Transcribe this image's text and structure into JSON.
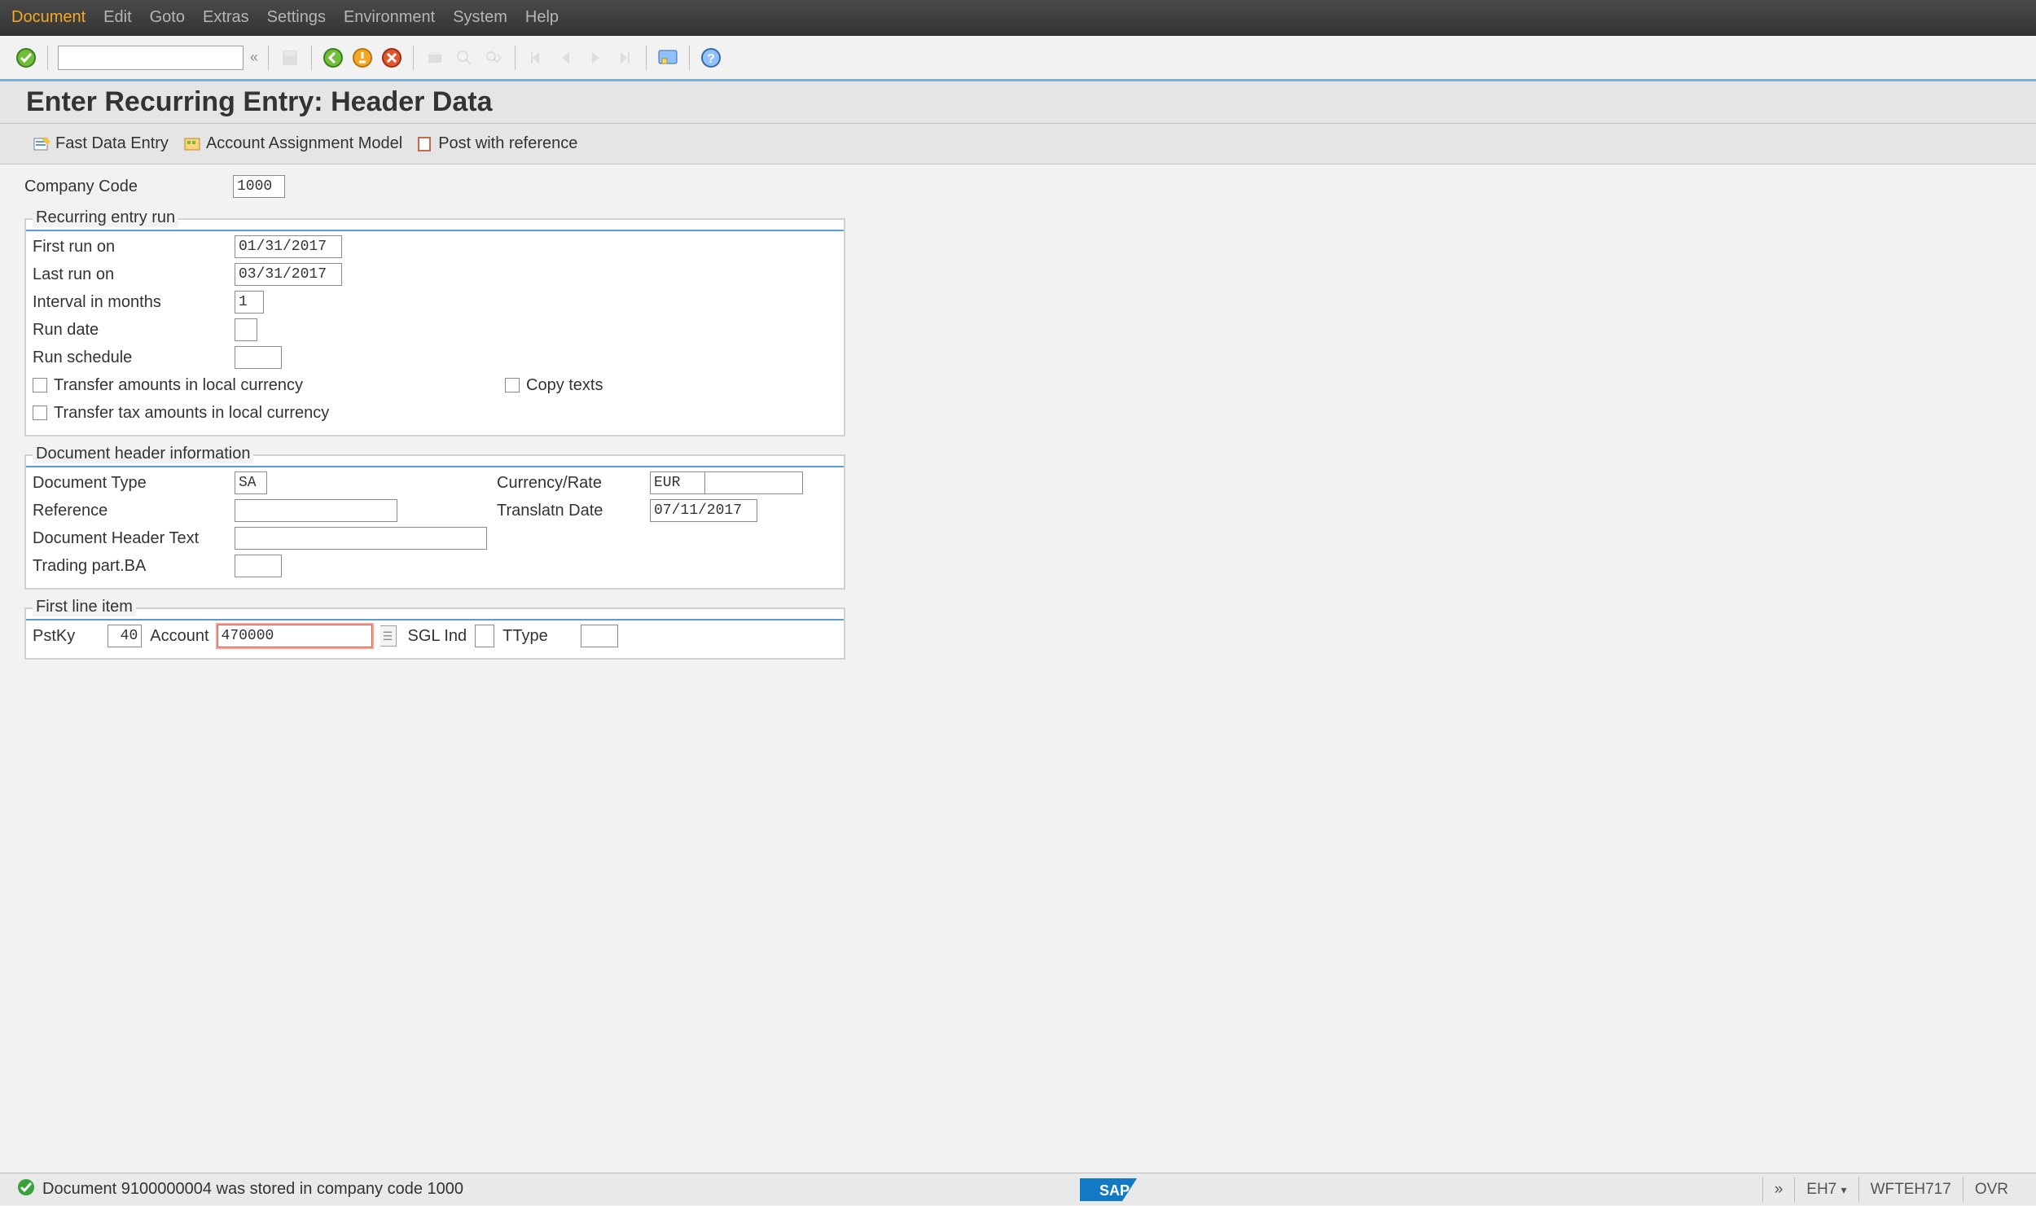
{
  "menubar": {
    "items": [
      "Document",
      "Edit",
      "Goto",
      "Extras",
      "Settings",
      "Environment",
      "System",
      "Help"
    ],
    "active_index": 0
  },
  "title": "Enter Recurring Entry: Header Data",
  "app_buttons": {
    "fast_entry": "Fast Data Entry",
    "acct_model": "Account Assignment Model",
    "post_ref": "Post with reference"
  },
  "header": {
    "company_code_label": "Company Code",
    "company_code": "1000"
  },
  "group_run": {
    "legend": "Recurring entry run",
    "first_run_label": "First run on",
    "first_run": "01/31/2017",
    "last_run_label": "Last run on",
    "last_run": "03/31/2017",
    "interval_label": "Interval in months",
    "interval": "1",
    "run_date_label": "Run date",
    "run_date": "",
    "run_sched_label": "Run schedule",
    "run_sched": "",
    "cb_transfer_amounts": "Transfer amounts in local currency",
    "cb_copy_texts": "Copy texts",
    "cb_transfer_tax": "Transfer tax amounts in local currency"
  },
  "group_doc": {
    "legend": "Document header information",
    "doctype_label": "Document Type",
    "doctype": "SA",
    "currency_label": "Currency/Rate",
    "currency": "EUR",
    "rate": "",
    "reference_label": "Reference",
    "reference": "",
    "transdate_label": "Translatn Date",
    "transdate": "07/11/2017",
    "headertext_label": "Document Header Text",
    "headertext": "",
    "trading_ba_label": "Trading part.BA",
    "trading_ba": ""
  },
  "group_line": {
    "legend": "First line item",
    "pstky_label": "PstKy",
    "pstky": "40",
    "account_label": "Account",
    "account": "470000",
    "sgl_label": "SGL Ind",
    "sgl": "",
    "ttype_label": "TType",
    "ttype": ""
  },
  "status": {
    "message": "Document 9100000004 was stored in company code 1000",
    "system": "EH7",
    "client": "WFTEH717",
    "mode": "OVR"
  }
}
